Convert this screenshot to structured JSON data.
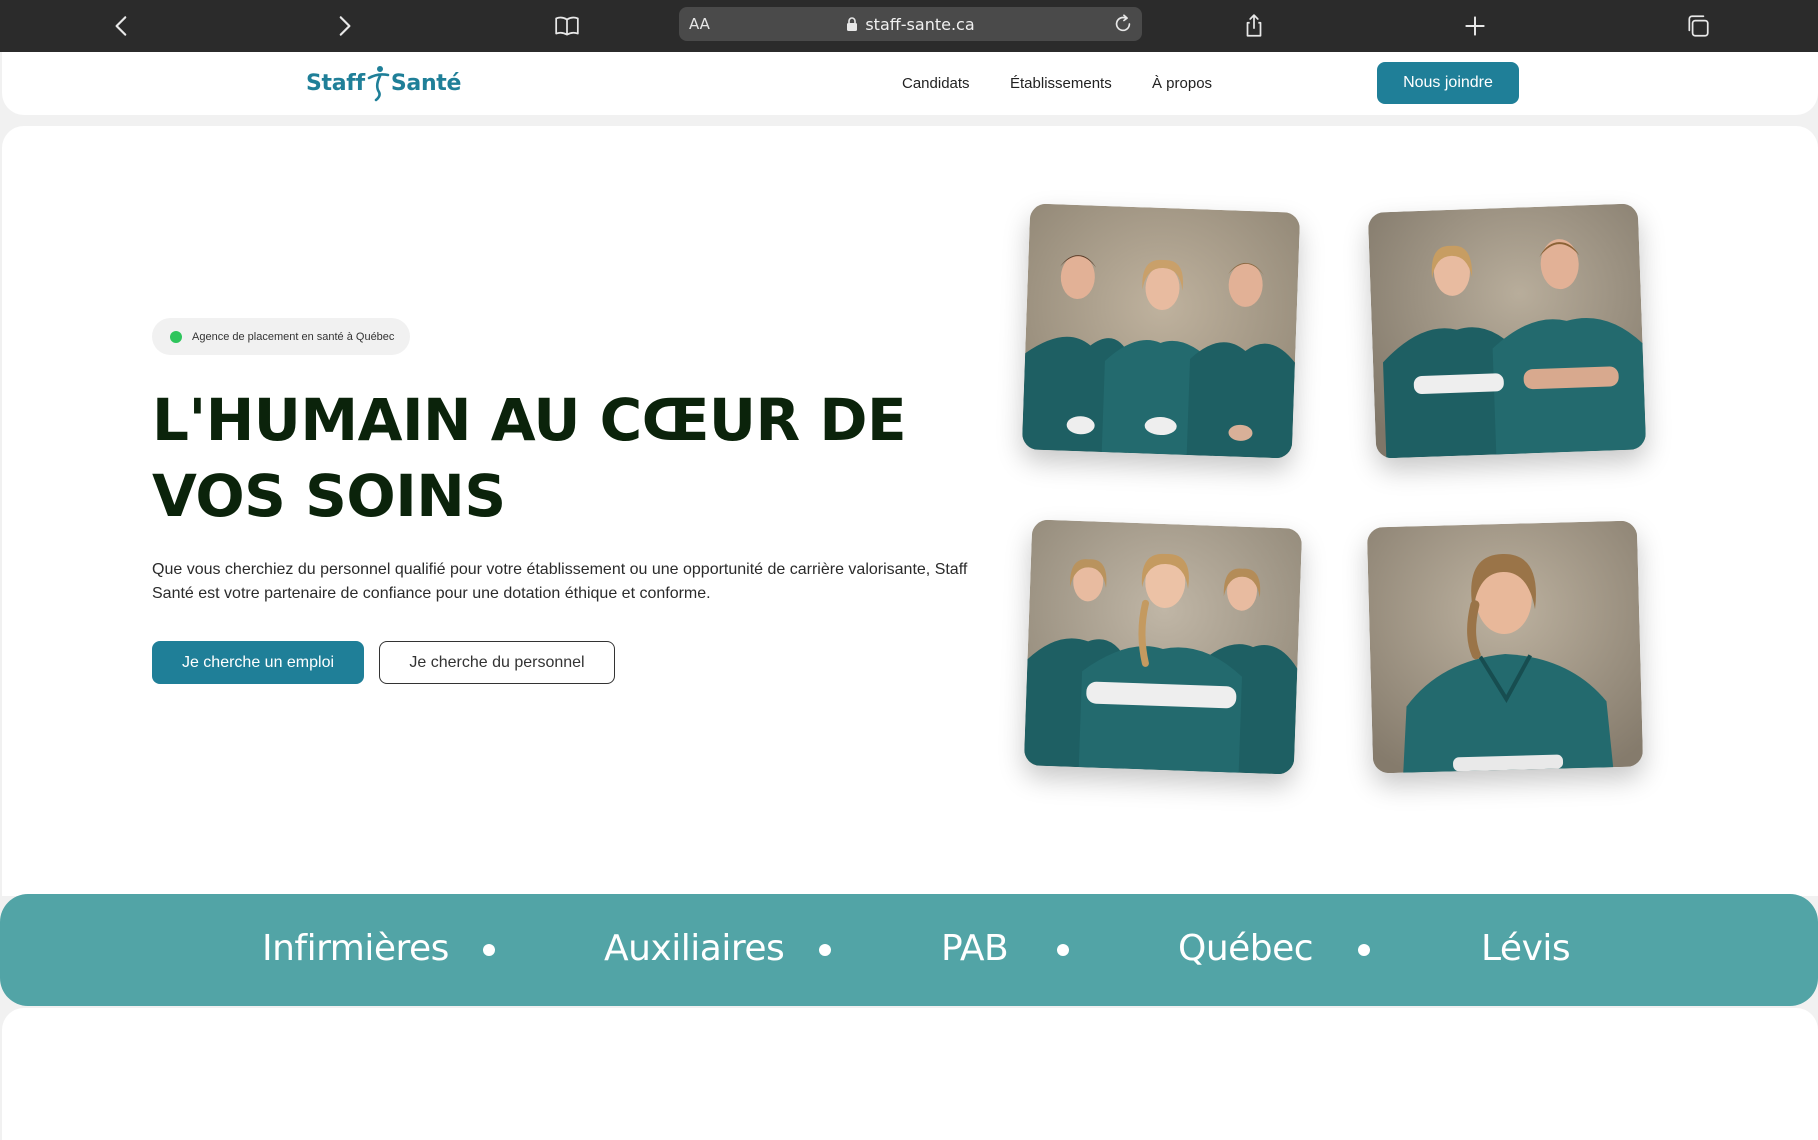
{
  "browser": {
    "url": "staff-sante.ca",
    "reader_label": "AA"
  },
  "header": {
    "logo": {
      "part1": "Staff",
      "part2": "Santé"
    },
    "nav": [
      {
        "label": "Candidats"
      },
      {
        "label": "Établissements"
      },
      {
        "label": "À propos"
      }
    ],
    "cta_label": "Nous joindre"
  },
  "hero": {
    "badge": "Agence de placement en santé à Québec",
    "title_line1": "L'HUMAIN AU CŒUR DE",
    "title_line2": "VOS SOINS",
    "description": "Que vous cherchiez du personnel qualifié pour votre établissement ou une opportunité de carrière valorisante, Staff Santé est votre partenaire de confiance pour une dotation éthique et conforme.",
    "primary_button": "Je cherche un emploi",
    "secondary_button": "Je cherche du personnel"
  },
  "ticker": {
    "items": [
      "Infirmières",
      "Auxiliaires",
      "PAB",
      "Québec",
      "Lévis"
    ]
  },
  "colors": {
    "brand_teal": "#1f7f98",
    "ticker_teal": "#52a4a6",
    "title_dark_green": "#0b230b",
    "badge_dot_green": "#2ec55c",
    "scrubs": "#1e5f63"
  }
}
